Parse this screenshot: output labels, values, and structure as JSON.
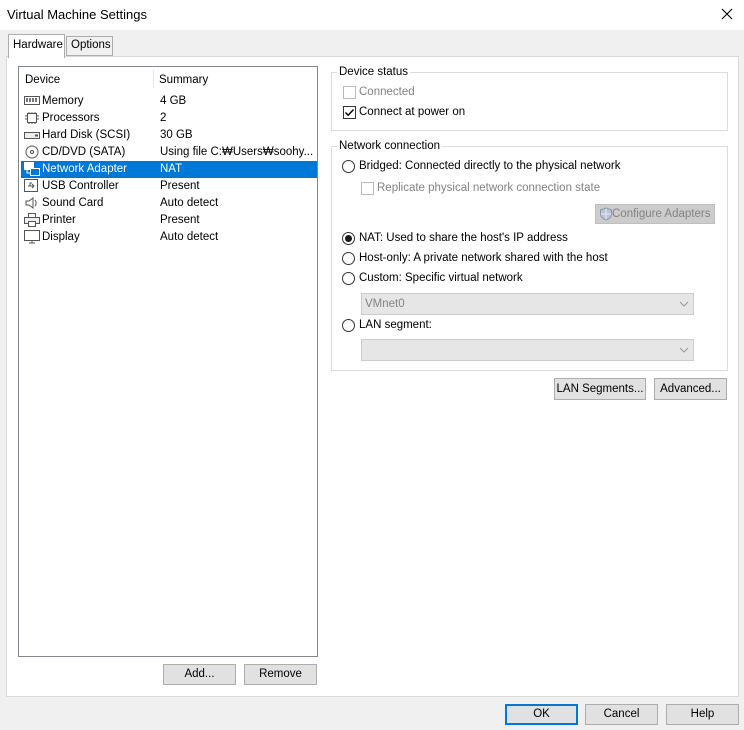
{
  "window": {
    "title": "Virtual Machine Settings"
  },
  "tabs": [
    {
      "label": "Hardware",
      "active": true
    },
    {
      "label": "Options",
      "active": false
    }
  ],
  "device_list": {
    "headers": {
      "device": "Device",
      "summary": "Summary"
    },
    "rows": [
      {
        "icon": "memory-icon",
        "name": "Memory",
        "summary": "4 GB",
        "selected": false
      },
      {
        "icon": "processor-icon",
        "name": "Processors",
        "summary": "2",
        "selected": false
      },
      {
        "icon": "hard-disk-icon",
        "name": "Hard Disk (SCSI)",
        "summary": "30 GB",
        "selected": false
      },
      {
        "icon": "cd-dvd-icon",
        "name": "CD/DVD (SATA)",
        "summary": "Using file C:₩Users₩soohy...",
        "selected": false
      },
      {
        "icon": "network-adapter-icon",
        "name": "Network Adapter",
        "summary": "NAT",
        "selected": true
      },
      {
        "icon": "usb-controller-icon",
        "name": "USB Controller",
        "summary": "Present",
        "selected": false
      },
      {
        "icon": "sound-card-icon",
        "name": "Sound Card",
        "summary": "Auto detect",
        "selected": false
      },
      {
        "icon": "printer-icon",
        "name": "Printer",
        "summary": "Present",
        "selected": false
      },
      {
        "icon": "display-icon",
        "name": "Display",
        "summary": "Auto detect",
        "selected": false
      }
    ]
  },
  "list_buttons": {
    "add": "Add...",
    "remove": "Remove"
  },
  "device_status": {
    "label": "Device status",
    "connected": {
      "label": "Connected",
      "checked": false,
      "enabled": false
    },
    "connect_at_power_on": {
      "label": "Connect at power on",
      "checked": true,
      "enabled": true
    }
  },
  "network_connection": {
    "label": "Network connection",
    "bridged": {
      "label": "Bridged: Connected directly to the physical network",
      "selected": false
    },
    "replicate": {
      "label": "Replicate physical network connection state",
      "checked": false,
      "enabled": false
    },
    "configure_adapters": "Configure Adapters",
    "nat": {
      "label": "NAT: Used to share the host's IP address",
      "selected": true
    },
    "host_only": {
      "label": "Host-only: A private network shared with the host",
      "selected": false
    },
    "custom": {
      "label": "Custom: Specific virtual network",
      "selected": false
    },
    "custom_value": "VMnet0",
    "lan_segment": {
      "label": "LAN segment:",
      "selected": false
    },
    "lan_segment_value": ""
  },
  "panel_buttons": {
    "lan_segments": "LAN Segments...",
    "advanced": "Advanced..."
  },
  "dialog_buttons": {
    "ok": "OK",
    "cancel": "Cancel",
    "help": "Help"
  },
  "colors": {
    "selection": "#0078d7",
    "default_button_border": "#0078d7"
  }
}
